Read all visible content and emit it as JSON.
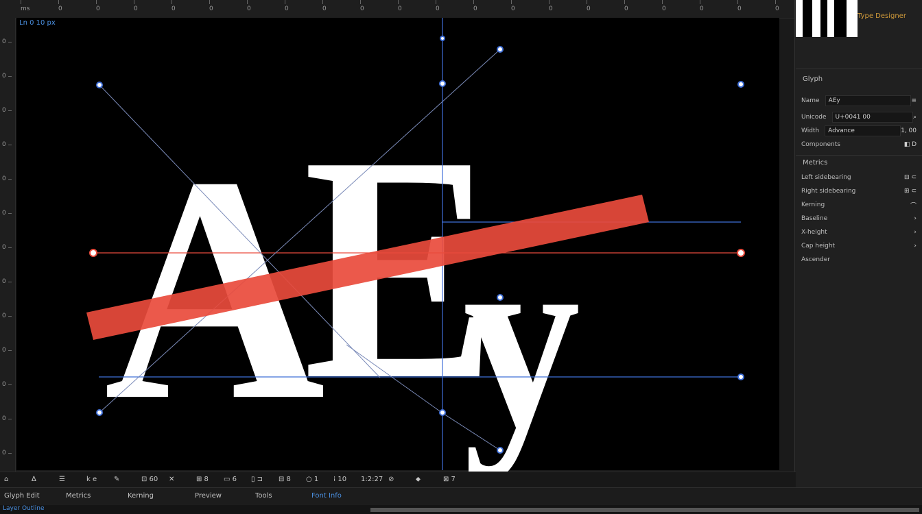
{
  "ruler": {
    "top_ticks": [
      "ms",
      "0",
      "0",
      "0",
      "0",
      "0",
      "0",
      "0",
      "0",
      "0",
      "0",
      "0",
      "0",
      "0",
      "0",
      "0",
      "0",
      "0",
      "0",
      "0",
      "0"
    ],
    "left_ticks": [
      "0",
      "0",
      "0",
      "0",
      "0",
      "0",
      "0",
      "0",
      "0",
      "0",
      "0",
      "0",
      "0"
    ]
  },
  "canvas": {
    "readout": "Ln 0 10 px",
    "glyph_text": [
      "A",
      "E",
      "y"
    ],
    "accent_color": "#e94b3c",
    "guide_color": "#3f6fd8"
  },
  "panel": {
    "header": "Type Designer",
    "properties_title": "Glyph",
    "rows": [
      {
        "label": "Name",
        "field": "AEy",
        "value": "≡"
      },
      {
        "label": "Unicode",
        "field": "U+0041 00",
        "value": "⌕"
      },
      {
        "label": "Width",
        "field": "Advance",
        "value": "1, 00"
      },
      {
        "label": "Components",
        "field": "",
        "value": "◧ D"
      }
    ],
    "metrics_title": "Metrics",
    "metric_rows": [
      {
        "label": "Left sidebearing",
        "value": "⊟ ⊂"
      },
      {
        "label": "Right sidebearing",
        "value": "⊞ ⊂"
      },
      {
        "label": "Kerning",
        "value": "⌒"
      },
      {
        "label": "Baseline",
        "value": "›"
      },
      {
        "label": "X-height",
        "value": "›"
      },
      {
        "label": "Cap height",
        "value": "›"
      },
      {
        "label": "Ascender",
        "value": ""
      }
    ]
  },
  "toolbar": {
    "tools": [
      "⌂",
      "∆",
      "☰",
      "k e",
      "✎",
      "⊡ 60",
      "✕",
      "⊞ 8",
      "▭ 6",
      "▯ ⊐",
      "⊟ 8",
      "○ 1",
      "⁞ 10",
      "1:2:27",
      "⊘",
      "⬥",
      "⊠ 7"
    ]
  },
  "tabs": {
    "items": [
      "Glyph Edit",
      "Metrics",
      "Kerning",
      "Preview",
      "Tools",
      "Font Info"
    ],
    "active_index": 5
  },
  "bottom": {
    "label": "Layer Outline"
  }
}
